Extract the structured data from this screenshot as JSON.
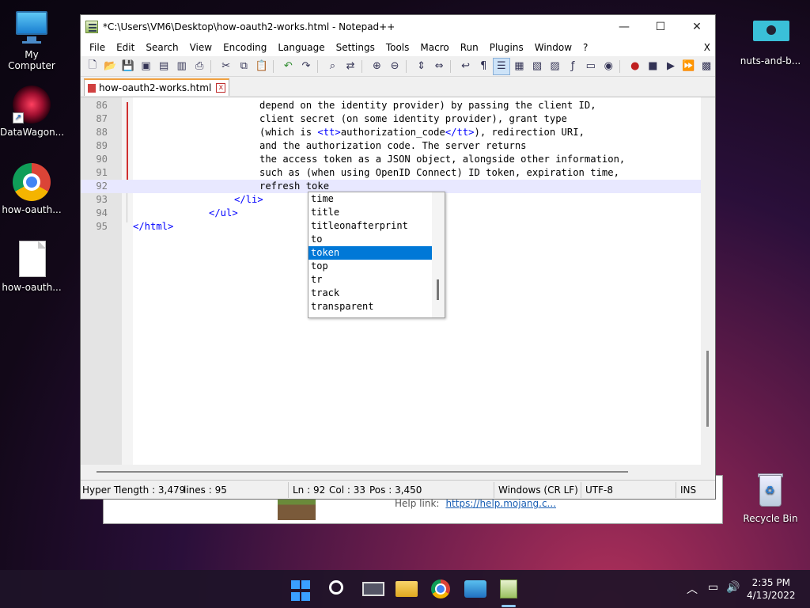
{
  "desktop": {
    "icons_left": [
      {
        "label": "My Computer"
      },
      {
        "label": "DataWagon..."
      },
      {
        "label": "how-oauth..."
      },
      {
        "label": "how-oauth..."
      }
    ],
    "icons_right": [
      {
        "label": "nuts-and-b..."
      },
      {
        "label": "Recycle Bin"
      }
    ]
  },
  "background_window": {
    "help_label": "Help link:",
    "help_link": "https://help.mojang.c..."
  },
  "window": {
    "title": "*C:\\Users\\VM6\\Desktop\\how-oauth2-works.html - Notepad++",
    "minimize": "—",
    "maximize": "☐",
    "close": "✕"
  },
  "menu": [
    "File",
    "Edit",
    "Search",
    "View",
    "Encoding",
    "Language",
    "Settings",
    "Tools",
    "Macro",
    "Run",
    "Plugins",
    "Window",
    "?"
  ],
  "menu_close": "X",
  "toolbar_icons": [
    "new-icon",
    "open-icon",
    "save-icon",
    "save-all-icon",
    "close-icon",
    "close-all-icon",
    "print-icon",
    "cut-icon",
    "copy-icon",
    "paste-icon",
    "undo-icon",
    "redo-icon",
    "find-icon",
    "replace-icon",
    "zoom-in-icon",
    "zoom-out-icon",
    "sync-v-icon",
    "sync-h-icon",
    "wrap-icon",
    "all-chars-icon",
    "indent-guide-icon",
    "lang-icon",
    "doc-map-icon",
    "func-list-icon",
    "folder-icon",
    "monitor-icon",
    "record-icon",
    "stop-icon",
    "play-icon",
    "play-multi-icon",
    "save-macro-icon"
  ],
  "tab": {
    "label": "how-oauth2-works.html",
    "close": "x"
  },
  "editor": {
    "lines": [
      {
        "num": "86",
        "text": "depend on the identity provider) by passing the client ID,"
      },
      {
        "num": "87",
        "text": "client secret (on some identity provider), grant type"
      },
      {
        "num": "88",
        "pre": "(which is ",
        "tag1": "<tt>",
        "mid": "authorization_code",
        "tag2": "</tt>",
        "post": "), redirection URI,"
      },
      {
        "num": "89",
        "text": "and the authorization code. The server returns"
      },
      {
        "num": "90",
        "text": "the access token as a JSON object, alongside other information,"
      },
      {
        "num": "91",
        "text": "such as (when using OpenID Connect) ID token, expiration time,"
      },
      {
        "num": "92",
        "text": "refresh toke"
      },
      {
        "num": "93",
        "tag": "</li>"
      },
      {
        "num": "94",
        "tag": "</ul>"
      },
      {
        "num": "95",
        "tag": "</html>"
      }
    ]
  },
  "autocomplete": {
    "items": [
      "time",
      "title",
      "titleonafterprint",
      "to",
      "token",
      "top",
      "tr",
      "track",
      "transparent"
    ],
    "selected": "token"
  },
  "status": {
    "doc_type": "Hyper T",
    "length": "length : 3,479",
    "lines": "lines : 95",
    "ln": "Ln : 92",
    "col": "Col : 33",
    "pos": "Pos : 3,450",
    "eol": "Windows (CR LF)",
    "encoding": "UTF-8",
    "mode": "INS"
  },
  "taskbar": {
    "time": "2:35 PM",
    "date": "4/13/2022"
  }
}
